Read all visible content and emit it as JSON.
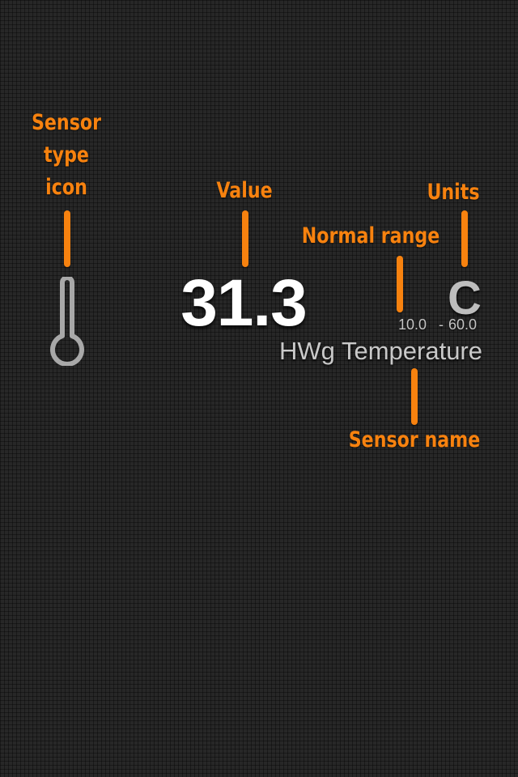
{
  "annotations": {
    "sensor_type_icon": [
      "Sensor",
      "type",
      "icon"
    ],
    "value": "Value",
    "units": "Units",
    "normal_range": "Normal range",
    "sensor_name": "Sensor name"
  },
  "sensor": {
    "icon": "thermometer-icon",
    "value": "31.3",
    "units": "C",
    "range_min": "10.0",
    "range_separator": "-",
    "range_max": "60.0",
    "name": "HWg Temperature"
  },
  "colors": {
    "background": "#272727",
    "annotation": "#f7820f",
    "value_text": "#ffffff",
    "secondary_text": "#c4c4c4",
    "icon": "#a8a8a8"
  }
}
